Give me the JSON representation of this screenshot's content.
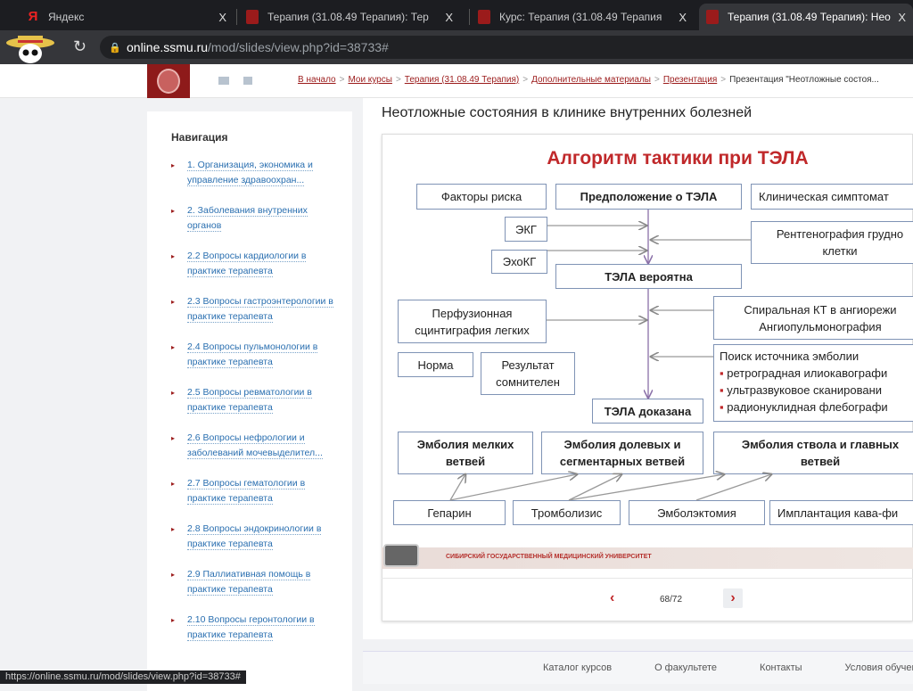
{
  "browser": {
    "tabs": [
      {
        "title": "Яндекс",
        "icon": "yandex-icon"
      },
      {
        "title": "Терапия (31.08.49 Терапия): Тер",
        "icon": "ssmu-icon"
      },
      {
        "title": "Курс: Терапия (31.08.49 Терапия",
        "icon": "ssmu-icon"
      },
      {
        "title": "Терапия (31.08.49 Терапия): Нео",
        "icon": "ssmu-icon",
        "active": true
      }
    ],
    "close": "X",
    "url_host": "online.ssmu.ru",
    "url_path": "/mod/slides/view.php?id=38733#",
    "status_url": "https://online.ssmu.ru/mod/slides/view.php?id=38733#"
  },
  "breadcrumbs": [
    "В начало",
    "Мои курсы",
    "Терапия (31.08.49 Терапия)",
    "Дополнительные материалы",
    "Презентация",
    "Презентация \"Неотложные состоя..."
  ],
  "breadcrumb_sep": ">",
  "sidebar": {
    "title": "Навигация",
    "bullet": "▸",
    "items": [
      "1. Организация, экономика и управление здравоохран...",
      "2. Заболевания внутренних органов",
      "2.2 Вопросы кардиологии в практике терапевта",
      "2.3 Вопросы гастроэнтерологии в практике терапевта",
      "2.4 Вопросы пульмонологии в практике терапевта",
      "2.5 Вопросы ревматологии в практике терапевта",
      "2.6 Вопросы нефрологии и заболеваний мочевыделител...",
      "2.7 Вопросы гематологии в практике терапевта",
      "2.8 Вопросы эндокринологии в практике терапевта",
      "2.9 Паллиативная помощь в практике терапевта",
      "2.10 Вопросы геронтологии в практике терапевта"
    ]
  },
  "main": {
    "title": "Неотложные состояния в клинике внутренних болезней"
  },
  "slide": {
    "title": "Алгоритм тактики при ТЭЛА",
    "boxes": {
      "risk": "Факторы риска",
      "suspect": "Предположение о ТЭЛА",
      "clinic": "Клиническая симптомат",
      "ecg": "ЭКГ",
      "xray": "Рентгенография грудно клетки",
      "echo": "ЭхоКГ",
      "probable": "ТЭЛА вероятна",
      "perf": "Перфузионная сцинтиграфия легких",
      "ct": "Спиральная КТ в ангиорежи Ангиопульмонография",
      "norm": "Норма",
      "doubt": "Результат сомнителен",
      "search_title": "Поиск источника эмболии",
      "search_items": [
        "ретроградная илиокавографи",
        "ультразвуковое сканировани",
        "радионуклидная флебографи"
      ],
      "proven": "ТЭЛА доказана",
      "small": "Эмболия мелких ветвей",
      "lobar": "Эмболия долевых и сегментарных ветвей",
      "trunk": "Эмболия ствола и главных ветвей",
      "heparin": "Гепарин",
      "thrombolysis": "Тромболизис",
      "embolectomy": "Эмболэктомия",
      "cava": "Имплантация кава-фи"
    },
    "banner": "СИБИРСКИЙ ГОСУДАРСТВЕННЫЙ МЕДИЦИНСКИЙ УНИВЕРСИТЕТ",
    "title_color": "#c0282a"
  },
  "pagination": {
    "prev": "‹",
    "next": "›",
    "page": "68/72"
  },
  "footer": [
    "Каталог курсов",
    "О факультете",
    "Контакты",
    "Условия обучени"
  ]
}
